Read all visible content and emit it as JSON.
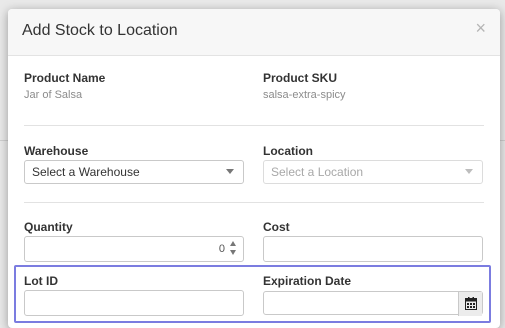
{
  "modal": {
    "title": "Add Stock to Location",
    "close_glyph": "×"
  },
  "product": {
    "name_label": "Product Name",
    "name_value": "Jar of Salsa",
    "sku_label": "Product SKU",
    "sku_value": "salsa-extra-spicy"
  },
  "warehouse": {
    "label": "Warehouse",
    "selected": "Select a Warehouse"
  },
  "location": {
    "label": "Location",
    "selected": "Select a Location"
  },
  "quantity": {
    "label": "Quantity",
    "value": "0"
  },
  "cost": {
    "label": "Cost",
    "value": ""
  },
  "lot": {
    "label": "Lot ID",
    "value": ""
  },
  "expiration": {
    "label": "Expiration Date",
    "value": ""
  },
  "icons": {
    "close": "close-icon",
    "caret": "chevron-down-icon",
    "calendar": "calendar-icon"
  },
  "colors": {
    "highlight": "#7b7ce0"
  }
}
